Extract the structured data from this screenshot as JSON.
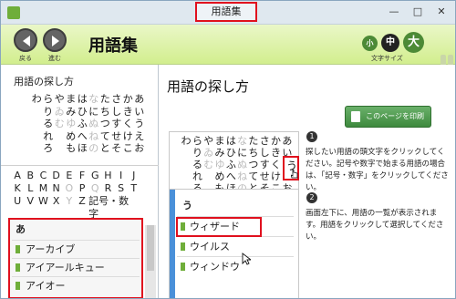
{
  "window": {
    "title": "用語集",
    "controls": [
      "—",
      "□",
      "✕"
    ]
  },
  "toolbar": {
    "back_label": "戻る",
    "forward_label": "進む",
    "app_title": "用語集",
    "font_size_label": "文字サイズ",
    "size_small": "小",
    "size_medium": "中",
    "size_large": "大"
  },
  "left": {
    "section_title": "用語の探し方",
    "kana_rows": [
      [
        "わ",
        "ら",
        "や",
        "ま",
        "は",
        "な",
        "た",
        "さ",
        "か",
        "あ"
      ],
      [
        "",
        "り",
        "ゐ",
        "み",
        "ひ",
        "に",
        "ち",
        "し",
        "き",
        "い"
      ],
      [
        "",
        "る",
        "む",
        "ゆ",
        "ふ",
        "ぬ",
        "つ",
        "す",
        "く",
        "う"
      ],
      [
        "",
        "れ",
        "",
        "め",
        "へ",
        "ね",
        "て",
        "せ",
        "け",
        "え"
      ],
      [
        "",
        "ろ",
        "",
        "も",
        "ほ",
        "の",
        "と",
        "そ",
        "こ",
        "お"
      ]
    ],
    "kana_dim": [
      "ゐ",
      "む",
      "ゆ",
      "な",
      "ね",
      "の",
      "ぬ"
    ],
    "alpha_rows": [
      [
        "A",
        "B",
        "C",
        "D",
        "E",
        "F",
        "G",
        "H",
        "I",
        "J"
      ],
      [
        "K",
        "L",
        "M",
        "N",
        "O",
        "P",
        "Q",
        "R",
        "S",
        "T"
      ],
      [
        "U",
        "V",
        "W",
        "X",
        "Y",
        "Z"
      ]
    ],
    "alpha_dim": [
      "O",
      "Q",
      "Y"
    ],
    "alpha_extra": "記号・数字",
    "list": {
      "head": "あ",
      "items": [
        "アーカイブ",
        "アイアールキュー",
        "アイオー"
      ]
    }
  },
  "main": {
    "title": "用語の探し方",
    "print_button": "このページを印刷",
    "kana_rows": [
      [
        "わ",
        "ら",
        "や",
        "ま",
        "は",
        "な",
        "た",
        "さ",
        "か",
        "あ"
      ],
      [
        "",
        "り",
        "ゐ",
        "み",
        "ひ",
        "に",
        "ち",
        "し",
        "き",
        "い"
      ],
      [
        "",
        "る",
        "む",
        "ゆ",
        "ふ",
        "ぬ",
        "つ",
        "す",
        "く",
        ""
      ],
      [
        "",
        "れ",
        "",
        "め",
        "へ",
        "ね",
        "て",
        "せ",
        "け",
        "え"
      ],
      [
        "",
        "ろ",
        "",
        "も",
        "ほ",
        "の",
        "と",
        "そ",
        "こ",
        "お"
      ]
    ],
    "highlight_kana": "う",
    "step1_num": "1",
    "step1_text": "探したい用語の頭文字をクリックしてください。記号や数字で始まる用語の場合は、「記号・数字」をクリックしてください。",
    "step2_num": "2",
    "step2_text": "画面左下に、用語の一覧が表示されます。用語をクリックして選択してください。",
    "panel2": {
      "head": "う",
      "items": [
        "ウィザード",
        "ウイルス",
        "ウィンドウ"
      ]
    }
  },
  "colors": {
    "accent_red": "#e0101e",
    "toolbar_green": "#d2ee8e",
    "bullet_green": "#6fae3a"
  }
}
